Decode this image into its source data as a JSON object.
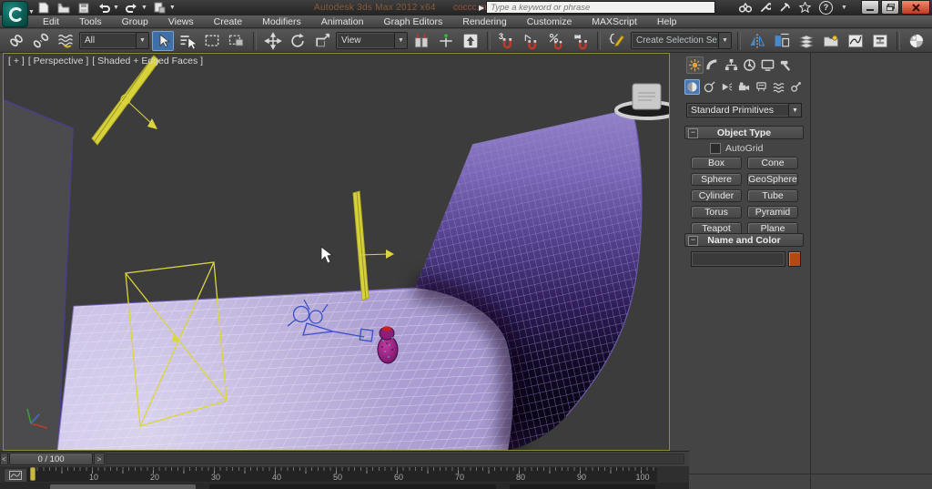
{
  "titlebar": {
    "app_title": "Autodesk 3ds Max 2012 x64",
    "document": "coccc.max",
    "search_placeholder": "Type a keyword or phrase",
    "help_glyph": "?"
  },
  "menu": {
    "items": [
      "Edit",
      "Tools",
      "Group",
      "Views",
      "Create",
      "Modifiers",
      "Animation",
      "Graph Editors",
      "Rendering",
      "Customize",
      "MAXScript",
      "Help"
    ]
  },
  "toolbar": {
    "selection_filter": "All",
    "coord_system": "View",
    "selection_set": "Create Selection Se",
    "snap_3_label": "3",
    "snap_percent_label": "%"
  },
  "viewport": {
    "label_general": "[ + ]",
    "label_pov": "[ Perspective ]",
    "label_shading": "[ Shaded + Edged Faces ]"
  },
  "command_panel": {
    "category_dropdown": "Standard Primitives",
    "object_type": {
      "title": "Object Type",
      "autogrid_label": "AutoGrid",
      "buttons": [
        "Box",
        "Cone",
        "Sphere",
        "GeoSphere",
        "Cylinder",
        "Tube",
        "Torus",
        "Pyramid",
        "Teapot",
        "Plane"
      ]
    },
    "name_and_color": {
      "title": "Name and Color",
      "name_value": ""
    }
  },
  "timeline": {
    "frame_display": "0 / 100",
    "prev_arrow": "<",
    "next_arrow": ">",
    "ruler_numbers": [
      "10",
      "20",
      "30",
      "40",
      "50",
      "60",
      "70",
      "80",
      "90",
      "100"
    ]
  },
  "colors": {
    "selected_tool_blue": "#3f6fa8",
    "swatch_orange": "#b5490f",
    "gizmo_yellow": "#dcd63c",
    "wireframe_blue": "#3a50c8",
    "floor_lavender": "#b3a6d6",
    "active_viewport_border": "#8f8c42"
  }
}
